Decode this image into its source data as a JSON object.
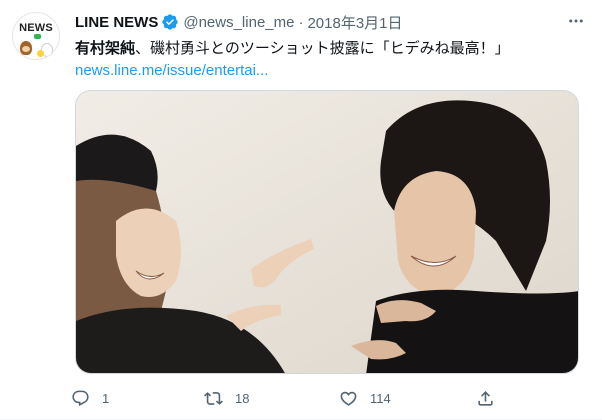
{
  "tweet": {
    "avatar_logo": "NEWS",
    "display_name": "LINE NEWS",
    "handle": "@news_line_me",
    "separator": "·",
    "date": "2018年3月1日",
    "text_bold": "有村架純",
    "text_rest": "、磯村勇斗とのツーショット披露に「ヒデみね最高！」",
    "link": "news.line.me/issue/entertai...",
    "counts": {
      "replies": "1",
      "retweets": "18",
      "likes": "114"
    }
  },
  "icons": {
    "verified": "verified-badge-icon",
    "more": "more-options-icon",
    "reply": "reply-icon",
    "retweet": "retweet-icon",
    "like": "heart-icon",
    "share": "share-icon"
  },
  "colors": {
    "link": "#1d9bf0",
    "verified": "#1d9bf0",
    "secondary_text": "#536471",
    "primary_text": "#0f1419"
  }
}
